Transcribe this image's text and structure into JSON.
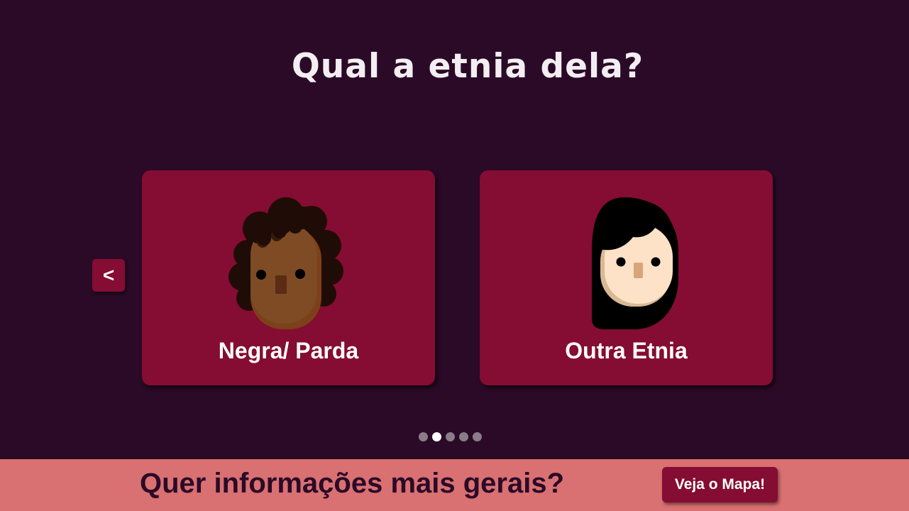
{
  "question": {
    "title": "Qual a etnia dela?"
  },
  "navigation": {
    "back_label": "<"
  },
  "options": [
    {
      "label": "Negra/ Parda",
      "icon": "black-woman-avatar-icon"
    },
    {
      "label": "Outra Etnia",
      "icon": "woman-avatar-icon"
    }
  ],
  "pagination": {
    "total": 5,
    "current": 2
  },
  "footer": {
    "text": "Quer informações mais gerais?",
    "button_label": "Veja o Mapa!"
  },
  "colors": {
    "background": "#2b0a27",
    "card": "#850c33",
    "footer": "#d97072",
    "text_light": "#ffffff",
    "text_dark": "#2b0a27"
  }
}
